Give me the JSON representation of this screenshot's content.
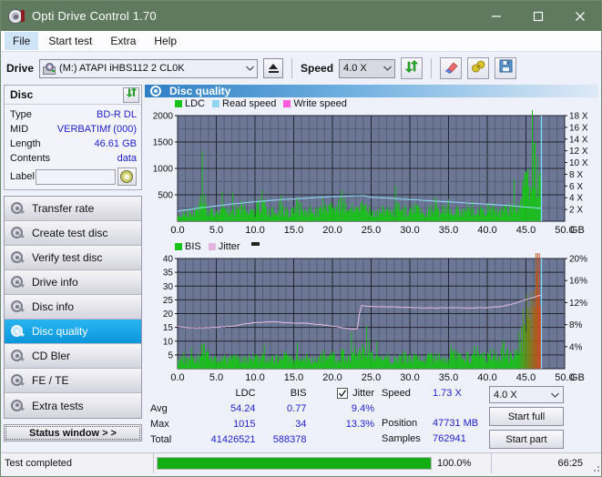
{
  "window": {
    "title": "Opti Drive Control 1.70",
    "icon": "disc-icon",
    "minimize": "minimize-icon",
    "maximize": "maximize-icon",
    "close": "close-icon"
  },
  "menubar": {
    "items": [
      {
        "label": "File",
        "selected": true
      },
      {
        "label": "Start test",
        "selected": false
      },
      {
        "label": "Extra",
        "selected": false
      },
      {
        "label": "Help",
        "selected": false
      }
    ]
  },
  "toolbar": {
    "drive_label": "Drive",
    "drive_value": "(M:)  ATAPI iHBS112  2 CL0K",
    "drive_icon": "optical-drive-icon",
    "eject_icon": "eject-icon",
    "speed_label": "Speed",
    "speed_value": "4.0 X",
    "refresh_icon": "refresh-icon",
    "erase_icon": "erase-icon",
    "plug_icon": "plug-icon",
    "save_icon": "save-icon"
  },
  "disc_panel": {
    "title": "Disc",
    "refresh_icon": "refresh-icon",
    "rows": [
      {
        "key": "Type",
        "value": "BD-R DL"
      },
      {
        "key": "MID",
        "value": "VERBATIMf (000)"
      },
      {
        "key": "Length",
        "value": "46.61 GB"
      },
      {
        "key": "Contents",
        "value": "data"
      }
    ],
    "label_key": "Label",
    "label_value": "",
    "label_placeholder": "",
    "label_button_icon": "cd-icon"
  },
  "sidebar": {
    "items": [
      {
        "label": "Transfer rate",
        "icon": "disc-transfer-icon",
        "active": false
      },
      {
        "label": "Create test disc",
        "icon": "disc-create-icon",
        "active": false
      },
      {
        "label": "Verify test disc",
        "icon": "disc-verify-icon",
        "active": false
      },
      {
        "label": "Drive info",
        "icon": "drive-info-icon",
        "active": false
      },
      {
        "label": "Disc info",
        "icon": "disc-info-icon",
        "active": false
      },
      {
        "label": "Disc quality",
        "icon": "disc-quality-icon",
        "active": true
      },
      {
        "label": "CD Bler",
        "icon": "cd-bler-icon",
        "active": false
      },
      {
        "label": "FE / TE",
        "icon": "fe-te-icon",
        "active": false
      },
      {
        "label": "Extra tests",
        "icon": "extra-tests-icon",
        "active": false
      }
    ],
    "status_button": "Status window > >"
  },
  "panel": {
    "title": "Disc quality",
    "icon": "disc-quality-icon"
  },
  "stats": {
    "columns": [
      "LDC",
      "BIS"
    ],
    "jitter_label": "Jitter",
    "jitter_checked": true,
    "rows": [
      {
        "key": "Avg",
        "ldc": "54.24",
        "bis": "0.77",
        "jitter": "9.4%"
      },
      {
        "key": "Max",
        "ldc": "1015",
        "bis": "34",
        "jitter": "13.3%"
      },
      {
        "key": "Total",
        "ldc": "41426521",
        "bis": "588378",
        "jitter": ""
      }
    ],
    "speed_key": "Speed",
    "speed_value": "1.73 X",
    "position_key": "Position",
    "position_value": "47731 MB",
    "samples_key": "Samples",
    "samples_value": "762941",
    "speed_select": "4.0 X",
    "start_full": "Start full",
    "start_part": "Start part"
  },
  "statusbar": {
    "message": "Test completed",
    "percent_label": "100.0%",
    "percent_value": 100,
    "elapsed": "66:25"
  },
  "colors": {
    "ldc": "#19c219",
    "bis": "#19c219",
    "read_speed": "#8fd6f5",
    "write_speed": "#ff5ae0",
    "jitter": "#e0b6e0",
    "plot_bg": "#6b7794",
    "accent": "#2222cc",
    "progress": "#14ad14",
    "titlebar": "#5f7a5f"
  },
  "chart_data": [
    {
      "type": "area",
      "name": "disc-quality-ldc-chart",
      "title": "",
      "xlabel": "GB",
      "ylabel": "",
      "xlim": [
        0,
        50
      ],
      "ylim": [
        0,
        2000
      ],
      "y2lim": [
        0,
        18
      ],
      "y2label": "X",
      "grid": true,
      "legend_position": "top-left",
      "xticks": [
        "0.0",
        "5.0",
        "10.0",
        "15.0",
        "20.0",
        "25.0",
        "30.0",
        "35.0",
        "40.0",
        "45.0",
        "50.0"
      ],
      "yticks": [
        "500",
        "1000",
        "1500",
        "2000"
      ],
      "y2ticks": [
        "2 X",
        "4 X",
        "6 X",
        "8 X",
        "10 X",
        "12 X",
        "14 X",
        "16 X",
        "18 X"
      ],
      "legend": [
        {
          "name": "LDC",
          "color": "#19c219"
        },
        {
          "name": "Read speed",
          "color": "#8fd6f5"
        },
        {
          "name": "Write speed",
          "color": "#ff5ae0"
        }
      ],
      "series": [
        {
          "name": "LDC",
          "type": "bar",
          "color": "#19c219",
          "x": [
            0.3,
            1.0,
            1.8,
            2.6,
            3.4,
            3.7,
            4.3,
            5.1,
            5.9,
            6.7,
            7.5,
            8.3,
            9.1,
            9.9,
            10.7,
            11.5,
            12.3,
            13.1,
            13.9,
            14.7,
            15.5,
            16.3,
            17.1,
            17.9,
            18.7,
            19.5,
            20.3,
            21.1,
            21.9,
            22.7,
            23.5,
            24.3,
            25.1,
            25.9,
            26.7,
            27.5,
            28.3,
            29.1,
            29.9,
            30.7,
            31.5,
            32.3,
            33.1,
            33.9,
            34.7,
            35.5,
            36.3,
            37.1,
            37.9,
            38.7,
            39.5,
            40.3,
            41.1,
            41.9,
            42.7,
            43.5,
            44.2,
            44.6,
            45.0,
            45.4,
            45.8,
            46.1,
            46.4,
            46.7,
            46.9
          ],
          "values": [
            120,
            180,
            150,
            210,
            480,
            160,
            190,
            170,
            230,
            140,
            200,
            260,
            150,
            180,
            420,
            200,
            170,
            240,
            190,
            150,
            300,
            180,
            220,
            160,
            190,
            250,
            170,
            380,
            200,
            160,
            230,
            300,
            190,
            170,
            210,
            150,
            260,
            180,
            200,
            240,
            170,
            190,
            310,
            180,
            220,
            160,
            200,
            280,
            170,
            230,
            190,
            260,
            200,
            180,
            240,
            300,
            420,
            620,
            740,
            830,
            900,
            980,
            1015,
            900,
            700
          ]
        },
        {
          "name": "Read speed",
          "type": "line",
          "color": "#8fd6f5",
          "axis": "y2",
          "x": [
            0.0,
            2.5,
            5.0,
            7.5,
            10.0,
            12.5,
            15.0,
            17.5,
            20.0,
            22.5,
            24.0,
            25.0,
            27.5,
            30.0,
            32.5,
            35.0,
            37.5,
            40.0,
            42.5,
            45.0,
            46.9
          ],
          "values": [
            1.7,
            2.2,
            2.6,
            3.0,
            3.3,
            3.6,
            3.8,
            4.0,
            4.2,
            4.3,
            4.4,
            4.1,
            3.9,
            3.7,
            3.5,
            3.3,
            3.1,
            2.9,
            2.7,
            2.4,
            2.2
          ]
        }
      ]
    },
    {
      "type": "area",
      "name": "disc-quality-bis-jitter-chart",
      "title": "",
      "xlabel": "GB",
      "ylabel": "",
      "xlim": [
        0,
        50
      ],
      "ylim": [
        0,
        40
      ],
      "y2lim": [
        0,
        20
      ],
      "y2label": "%",
      "grid": true,
      "legend_position": "top-left",
      "xticks": [
        "0.0",
        "5.0",
        "10.0",
        "15.0",
        "20.0",
        "25.0",
        "30.0",
        "35.0",
        "40.0",
        "45.0",
        "50.0"
      ],
      "yticks": [
        "5",
        "10",
        "15",
        "20",
        "25",
        "30",
        "35",
        "40"
      ],
      "y2ticks": [
        "4%",
        "8%",
        "12%",
        "16%",
        "20%"
      ],
      "legend": [
        {
          "name": "BIS",
          "color": "#19c219"
        },
        {
          "name": "Jitter",
          "color": "#e0b6e0"
        }
      ],
      "series": [
        {
          "name": "BIS",
          "type": "bar",
          "color": "#19c219",
          "x": [
            0.4,
            1.2,
            2.0,
            2.8,
            3.6,
            4.4,
            5.2,
            6.0,
            6.8,
            7.6,
            8.4,
            9.2,
            10.0,
            10.8,
            11.6,
            12.4,
            13.2,
            14.0,
            14.8,
            15.6,
            16.4,
            17.2,
            18.0,
            18.8,
            19.6,
            20.4,
            21.2,
            22.0,
            22.8,
            23.6,
            24.4,
            25.2,
            26.0,
            26.8,
            27.6,
            28.4,
            29.2,
            30.0,
            30.8,
            31.6,
            32.4,
            33.2,
            34.0,
            34.8,
            35.6,
            36.4,
            37.2,
            38.0,
            38.8,
            39.6,
            40.4,
            41.2,
            42.0,
            42.8,
            43.6,
            44.2,
            44.6,
            45.0,
            45.4,
            45.8,
            46.2,
            46.5,
            46.8
          ],
          "values": [
            3.2,
            3.5,
            3.0,
            3.8,
            10.5,
            3.4,
            3.1,
            3.6,
            3.3,
            4.0,
            3.2,
            3.9,
            3.5,
            4.2,
            3.0,
            3.7,
            3.4,
            4.5,
            3.2,
            3.8,
            3.6,
            3.1,
            4.0,
            3.4,
            5.2,
            3.7,
            4.8,
            3.5,
            6.0,
            5.5,
            9.0,
            4.2,
            3.8,
            3.5,
            4.0,
            3.2,
            4.4,
            3.6,
            3.9,
            3.3,
            4.6,
            3.7,
            4.1,
            3.4,
            5.0,
            3.8,
            4.3,
            3.5,
            5.6,
            4.0,
            4.8,
            3.9,
            6.2,
            4.5,
            7.0,
            9.5,
            12.0,
            14.5,
            17.5,
            22.0,
            28.0,
            33.0,
            26.0
          ]
        },
        {
          "name": "Jitter",
          "type": "line",
          "color": "#e0b6e0",
          "axis": "y2",
          "x": [
            0.0,
            1.0,
            2.5,
            5.0,
            7.5,
            9.0,
            10.5,
            12.0,
            13.5,
            15.0,
            17.0,
            19.0,
            21.0,
            22.5,
            23.3,
            23.6,
            25.0,
            27.5,
            30.0,
            32.5,
            35.0,
            37.5,
            40.0,
            42.0,
            43.5,
            44.2,
            45.0,
            45.8,
            46.5,
            46.9
          ],
          "values": [
            7.7,
            7.5,
            7.4,
            7.5,
            7.8,
            8.2,
            8.4,
            8.5,
            8.4,
            8.3,
            8.2,
            7.9,
            7.5,
            7.2,
            7.3,
            11.5,
            11.3,
            11.2,
            11.1,
            11.0,
            11.1,
            11.0,
            11.1,
            11.3,
            11.8,
            12.2,
            12.5,
            12.8,
            13.2,
            13.3
          ]
        }
      ]
    }
  ]
}
